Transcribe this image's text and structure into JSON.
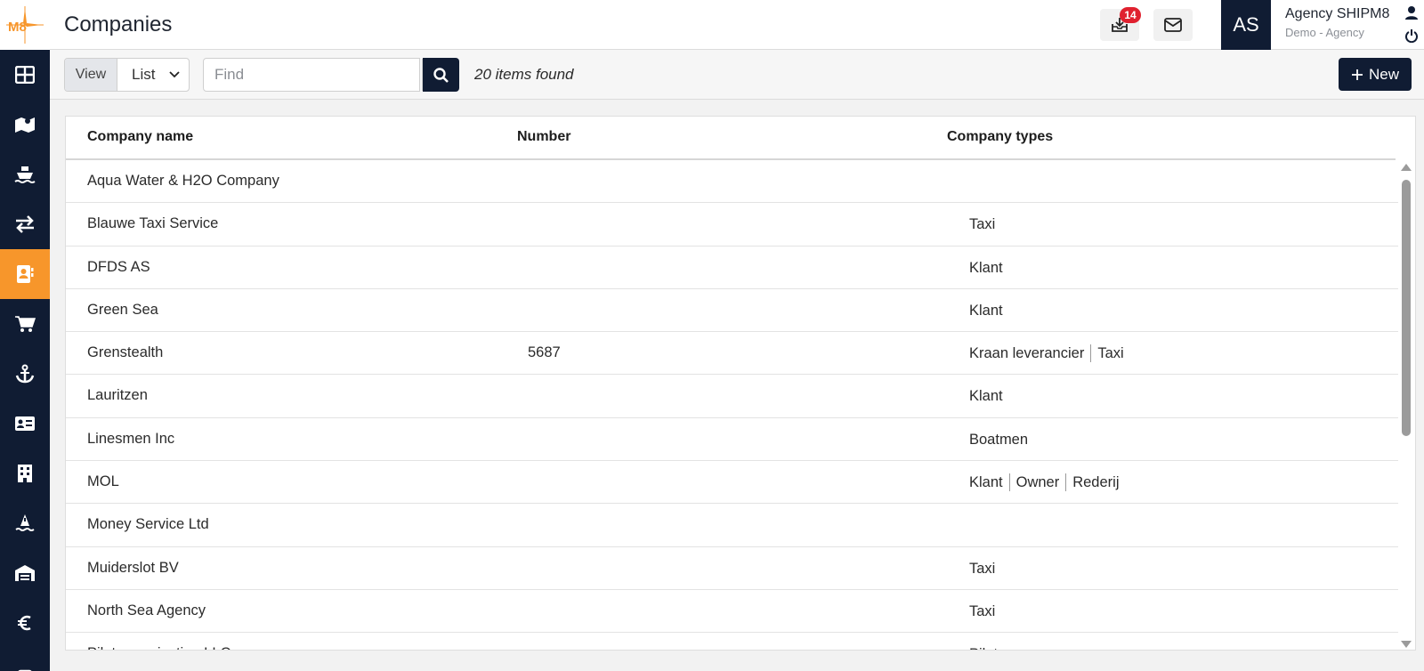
{
  "app": {
    "logo_text": "M8",
    "page_title": "Companies"
  },
  "header": {
    "downloads_badge": "14",
    "avatar_initials": "AS",
    "agency_name": "Agency SHIPM8",
    "agency_sub": "Demo - Agency"
  },
  "sidebar": {
    "items": [
      {
        "icon": "dashboard-grid-icon",
        "active": false
      },
      {
        "icon": "map-icon",
        "active": false
      },
      {
        "icon": "ship-icon",
        "active": false
      },
      {
        "icon": "transfer-arrows-icon",
        "active": false
      },
      {
        "icon": "address-book-icon",
        "active": true
      },
      {
        "icon": "cart-icon",
        "active": false
      },
      {
        "icon": "anchor-icon",
        "active": false
      },
      {
        "icon": "id-card-icon",
        "active": false
      },
      {
        "icon": "building-icon",
        "active": false
      },
      {
        "icon": "buoy-icon",
        "active": false
      },
      {
        "icon": "warehouse-icon",
        "active": false
      },
      {
        "icon": "euro-icon",
        "active": false
      },
      {
        "icon": "more-icon",
        "active": false
      }
    ],
    "active_color": "#f7962b",
    "background_color": "#101c33"
  },
  "toolbar": {
    "view_label": "View",
    "view_value": "List",
    "find_placeholder": "Find",
    "result_count": "20 items found",
    "new_label": "New"
  },
  "table": {
    "columns": [
      "Company name",
      "Number",
      "Company types"
    ],
    "rows": [
      {
        "name": "Aqua Water & H2O Company",
        "number": "",
        "types": []
      },
      {
        "name": "Blauwe Taxi Service",
        "number": "",
        "types": [
          "Taxi"
        ]
      },
      {
        "name": "DFDS AS",
        "number": "",
        "types": [
          "Klant"
        ]
      },
      {
        "name": "Green Sea",
        "number": "",
        "types": [
          "Klant"
        ]
      },
      {
        "name": "Grenstealth",
        "number": "5687",
        "types": [
          "Kraan leverancier",
          "Taxi"
        ]
      },
      {
        "name": "Lauritzen",
        "number": "",
        "types": [
          "Klant"
        ]
      },
      {
        "name": "Linesmen Inc",
        "number": "",
        "types": [
          "Boatmen"
        ]
      },
      {
        "name": "MOL",
        "number": "",
        "types": [
          "Klant",
          "Owner",
          "Rederij"
        ]
      },
      {
        "name": "Money Service Ltd",
        "number": "",
        "types": []
      },
      {
        "name": "Muiderslot BV",
        "number": "",
        "types": [
          "Taxi"
        ]
      },
      {
        "name": "North Sea Agency",
        "number": "",
        "types": [
          "Taxi"
        ]
      },
      {
        "name": "Pilot organisation LLC",
        "number": "",
        "types": [
          "Pilot"
        ]
      }
    ]
  }
}
